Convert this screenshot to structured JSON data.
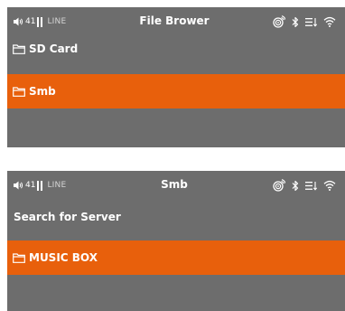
{
  "colors": {
    "panel_background": "#6d6d6d",
    "selection": "#e8600c",
    "text": "#ffffff"
  },
  "screens": [
    {
      "status_bar": {
        "volume_icon": "speaker-icon",
        "volume_value": "41",
        "level_icon": "level-meter-icon",
        "input": "LINE",
        "title": "File Brower",
        "icons": [
          "cast-icon",
          "bluetooth-icon",
          "playlist-icon",
          "wifi-icon"
        ]
      },
      "items": [
        {
          "label": "SD Card",
          "icon": "folder-icon",
          "selected": false
        },
        {
          "label": "Smb",
          "icon": "folder-icon",
          "selected": true
        }
      ]
    },
    {
      "status_bar": {
        "volume_icon": "speaker-icon",
        "volume_value": "41",
        "level_icon": "level-meter-icon",
        "input": "LINE",
        "title": "Smb",
        "icons": [
          "cast-icon",
          "bluetooth-icon",
          "playlist-icon",
          "wifi-icon"
        ]
      },
      "items": [
        {
          "label": "Search for Server",
          "icon": null,
          "selected": false
        },
        {
          "label": "MUSIC BOX",
          "icon": "folder-icon",
          "selected": true
        }
      ]
    }
  ]
}
